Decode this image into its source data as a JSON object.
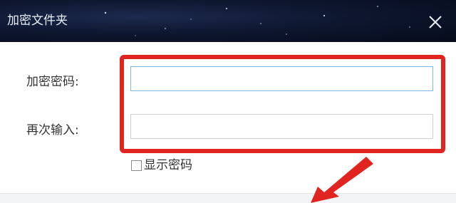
{
  "window": {
    "title": "加密文件夹",
    "close_icon": "close-icon"
  },
  "form": {
    "password_label": "加密密码:",
    "password_value": "",
    "confirm_label": "再次输入:",
    "confirm_value": "",
    "show_password_label": "显示密码",
    "show_password_checked": false
  },
  "colors": {
    "titlebar": "#0e1730",
    "highlight": "#e02420",
    "field_focus_border": "#7eb6e6"
  }
}
